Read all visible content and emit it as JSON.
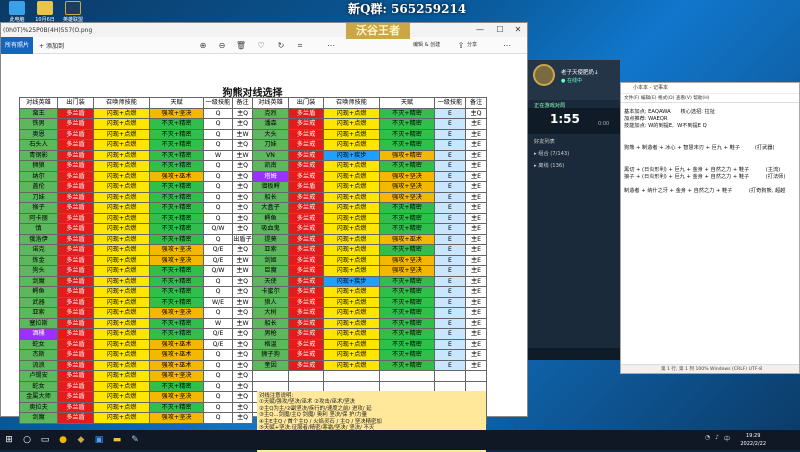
{
  "desktop": {
    "icons": [
      {
        "label": "此电脑",
        "color": "#3aa0e8"
      },
      {
        "label": "10月6日",
        "color": "#e8c44a"
      },
      {
        "label": "英雄联盟",
        "color": "#1f3c5c"
      }
    ],
    "qq_group": "新Q群: 565259214",
    "watermark": "沃谷王者"
  },
  "viewer": {
    "title": "(0h0T)%25P0B(4H)557(O.png",
    "all_photos": "所有照片",
    "add": "+ 添加到",
    "edit_create": "编辑 & 创建",
    "share": "分享",
    "controls": {
      "minimize": "—",
      "maximize": "☐",
      "close": "✕"
    }
  },
  "sheet": {
    "title": "狗熊对线选择",
    "headers": [
      "对线英雄",
      "出门装",
      "召唤师技能",
      "天赋",
      "一级技能",
      "备注",
      "对线英雄",
      "出门装",
      "召唤师技能",
      "天赋",
      "一级技能",
      "备注"
    ],
    "rows": [
      [
        [
          "蛮王",
          "g"
        ],
        [
          "多兰盾",
          "r"
        ],
        [
          "闪现+点燃",
          "y"
        ],
        [
          "强攻+坚决",
          "o"
        ],
        [
          "Q",
          "w"
        ],
        [
          "主Q",
          "w"
        ],
        [
          "克烈",
          "g"
        ],
        [
          "多兰盾",
          "r"
        ],
        [
          "闪现+点燃",
          "y"
        ],
        [
          "不灭+精密",
          "gr"
        ],
        [
          "E",
          "lb"
        ],
        [
          "主Q",
          "w"
        ]
      ],
      [
        [
          "铁男",
          "g"
        ],
        [
          "多兰盾",
          "r"
        ],
        [
          "闪现+点燃",
          "y"
        ],
        [
          "不灭+精密",
          "gr"
        ],
        [
          "Q",
          "w"
        ],
        [
          "主Q",
          "w"
        ],
        [
          "潘森",
          "g"
        ],
        [
          "多兰戒",
          "r"
        ],
        [
          "闪现+点燃",
          "y"
        ],
        [
          "不灭+精密",
          "gr"
        ],
        [
          "E",
          "lb"
        ],
        [
          "主E",
          "w"
        ]
      ],
      [
        [
          "奥恩",
          "g"
        ],
        [
          "多兰盾",
          "r"
        ],
        [
          "闪现+点燃",
          "y"
        ],
        [
          "不灭+精密",
          "gr"
        ],
        [
          "Q",
          "w"
        ],
        [
          "主W",
          "w"
        ],
        [
          "大头",
          "g"
        ],
        [
          "多兰戒",
          "r"
        ],
        [
          "闪现+点燃",
          "y"
        ],
        [
          "不灭+精密",
          "gr"
        ],
        [
          "E",
          "lb"
        ],
        [
          "主E",
          "w"
        ]
      ],
      [
        [
          "石头人",
          "g"
        ],
        [
          "多兰盾",
          "r"
        ],
        [
          "闪现+点燃",
          "y"
        ],
        [
          "不灭+精密",
          "gr"
        ],
        [
          "Q",
          "w"
        ],
        [
          "主Q",
          "w"
        ],
        [
          "刀妹",
          "g"
        ],
        [
          "多兰戒",
          "r"
        ],
        [
          "闪现+点燃",
          "y"
        ],
        [
          "不灭+精密",
          "gr"
        ],
        [
          "E",
          "lb"
        ],
        [
          "主E",
          "w"
        ]
      ],
      [
        [
          "青钢影",
          "g"
        ],
        [
          "多兰盾",
          "r"
        ],
        [
          "闪现+点燃",
          "y"
        ],
        [
          "不灭+精密",
          "gr"
        ],
        [
          "W",
          "w"
        ],
        [
          "主W",
          "w"
        ],
        [
          "VN",
          "g"
        ],
        [
          "多兰戒",
          "r"
        ],
        [
          "闪现+疾步",
          "b"
        ],
        [
          "强攻+精密",
          "o"
        ],
        [
          "E",
          "lb"
        ],
        [
          "主E",
          "w"
        ]
      ],
      [
        [
          "狮狼",
          "g"
        ],
        [
          "多兰盾",
          "r"
        ],
        [
          "闪现+点燃",
          "y"
        ],
        [
          "不灭+精密",
          "gr"
        ],
        [
          "Q",
          "w"
        ],
        [
          "主Q",
          "w"
        ],
        [
          "凯南",
          "g"
        ],
        [
          "多兰戒",
          "r"
        ],
        [
          "闪现+点燃",
          "y"
        ],
        [
          "不灭+精密",
          "gr"
        ],
        [
          "E",
          "lb"
        ],
        [
          "主E",
          "w"
        ]
      ],
      [
        [
          "纳尔",
          "g"
        ],
        [
          "多兰盾",
          "r"
        ],
        [
          "闪现+点燃",
          "y"
        ],
        [
          "强攻+巫术",
          "o"
        ],
        [
          "Q",
          "w"
        ],
        [
          "主Q",
          "w"
        ],
        [
          "塔姆",
          "p"
        ],
        [
          "多兰戒",
          "r"
        ],
        [
          "闪现+点燃",
          "y"
        ],
        [
          "强攻+坚决",
          "o"
        ],
        [
          "E",
          "lb"
        ],
        [
          "主E",
          "w"
        ]
      ],
      [
        [
          "盖伦",
          "g"
        ],
        [
          "多兰盾",
          "r"
        ],
        [
          "闪现+点燃",
          "y"
        ],
        [
          "不灭+精密",
          "gr"
        ],
        [
          "Q",
          "w"
        ],
        [
          "主Q",
          "w"
        ],
        [
          "潜板鳄",
          "g"
        ],
        [
          "多兰盾",
          "r"
        ],
        [
          "闪现+点燃",
          "y"
        ],
        [
          "强攻+坚决",
          "o"
        ],
        [
          "E",
          "lb"
        ],
        [
          "主E",
          "w"
        ]
      ],
      [
        [
          "刀妹",
          "g"
        ],
        [
          "多兰盾",
          "r"
        ],
        [
          "闪现+点燃",
          "y"
        ],
        [
          "不灭+精密",
          "gr"
        ],
        [
          "Q",
          "w"
        ],
        [
          "主Q",
          "w"
        ],
        [
          "船长",
          "g"
        ],
        [
          "多兰戒",
          "r"
        ],
        [
          "闪现+点燃",
          "y"
        ],
        [
          "强攻+坚决",
          "o"
        ],
        [
          "E",
          "lb"
        ],
        [
          "主E",
          "w"
        ]
      ],
      [
        [
          "猴子",
          "g"
        ],
        [
          "多兰盾",
          "r"
        ],
        [
          "闪现+点燃",
          "y"
        ],
        [
          "不灭+精密",
          "gr"
        ],
        [
          "Q",
          "w"
        ],
        [
          "主Q",
          "w"
        ],
        [
          "大盒子",
          "g"
        ],
        [
          "多兰戒",
          "r"
        ],
        [
          "闪现+点燃",
          "y"
        ],
        [
          "不灭+精密",
          "gr"
        ],
        [
          "E",
          "lb"
        ],
        [
          "主E",
          "w"
        ]
      ],
      [
        [
          "阿卡丽",
          "g"
        ],
        [
          "多兰盾",
          "r"
        ],
        [
          "闪现+点燃",
          "y"
        ],
        [
          "不灭+精密",
          "gr"
        ],
        [
          "Q",
          "w"
        ],
        [
          "主Q",
          "w"
        ],
        [
          "鳄鱼",
          "g"
        ],
        [
          "多兰戒",
          "r"
        ],
        [
          "闪现+点燃",
          "y"
        ],
        [
          "不灭+精密",
          "gr"
        ],
        [
          "E",
          "lb"
        ],
        [
          "主E",
          "w"
        ]
      ],
      [
        [
          "慎",
          "g"
        ],
        [
          "多兰盾",
          "r"
        ],
        [
          "闪现+点燃",
          "y"
        ],
        [
          "不灭+精密",
          "gr"
        ],
        [
          "Q/W",
          "w"
        ],
        [
          "主Q",
          "w"
        ],
        [
          "吸血鬼",
          "g"
        ],
        [
          "多兰戒",
          "r"
        ],
        [
          "闪现+点燃",
          "y"
        ],
        [
          "不灭+精密",
          "gr"
        ],
        [
          "E",
          "lb"
        ],
        [
          "主E",
          "w"
        ]
      ],
      [
        [
          "俄洛伊",
          "g"
        ],
        [
          "多兰盾",
          "r"
        ],
        [
          "闪现+点燃",
          "y"
        ],
        [
          "不灭+精密",
          "gr"
        ],
        [
          "Q",
          "w"
        ],
        [
          "出盾子",
          "w"
        ],
        [
          "提莫",
          "g"
        ],
        [
          "多兰戒",
          "r"
        ],
        [
          "闪现+点燃",
          "y"
        ],
        [
          "强攻+巫术",
          "o"
        ],
        [
          "E",
          "lb"
        ],
        [
          "主E",
          "w"
        ]
      ],
      [
        [
          "诺克",
          "g"
        ],
        [
          "多兰盾",
          "r"
        ],
        [
          "闪现+点燃",
          "y"
        ],
        [
          "强攻+坚决",
          "o"
        ],
        [
          "Q/E",
          "w"
        ],
        [
          "主Q",
          "w"
        ],
        [
          "亚索",
          "g"
        ],
        [
          "多兰戒",
          "r"
        ],
        [
          "闪现+点燃",
          "y"
        ],
        [
          "不灭+精密",
          "gr"
        ],
        [
          "E",
          "lb"
        ],
        [
          "主E",
          "w"
        ]
      ],
      [
        [
          "炼金",
          "g"
        ],
        [
          "多兰盾",
          "r"
        ],
        [
          "闪现+点燃",
          "y"
        ],
        [
          "强攻+坚决",
          "o"
        ],
        [
          "Q/E",
          "w"
        ],
        [
          "主W",
          "w"
        ],
        [
          "剑姬",
          "g"
        ],
        [
          "多兰戒",
          "r"
        ],
        [
          "闪现+点燃",
          "y"
        ],
        [
          "强攻+坚决",
          "o"
        ],
        [
          "E",
          "lb"
        ],
        [
          "主E",
          "w"
        ]
      ],
      [
        [
          "狗头",
          "g"
        ],
        [
          "多兰盾",
          "r"
        ],
        [
          "闪现+点燃",
          "y"
        ],
        [
          "不灭+精密",
          "gr"
        ],
        [
          "Q/W",
          "w"
        ],
        [
          "主W",
          "w"
        ],
        [
          "巨魔",
          "g"
        ],
        [
          "多兰戒",
          "r"
        ],
        [
          "闪现+点燃",
          "y"
        ],
        [
          "强攻+坚决",
          "o"
        ],
        [
          "E",
          "lb"
        ],
        [
          "主E",
          "w"
        ]
      ],
      [
        [
          "剑魔",
          "g"
        ],
        [
          "多兰盾",
          "r"
        ],
        [
          "闪现+点燃",
          "y"
        ],
        [
          "不灭+精密",
          "gr"
        ],
        [
          "Q",
          "w"
        ],
        [
          "主Q",
          "w"
        ],
        [
          "天使",
          "g"
        ],
        [
          "多兰戒",
          "r"
        ],
        [
          "闪现+疾步",
          "b"
        ],
        [
          "不灭+精密",
          "gr"
        ],
        [
          "E",
          "lb"
        ],
        [
          "主E",
          "w"
        ]
      ],
      [
        [
          "鳄鱼",
          "g"
        ],
        [
          "多兰盾",
          "r"
        ],
        [
          "闪现+点燃",
          "y"
        ],
        [
          "不灭+精密",
          "gr"
        ],
        [
          "Q",
          "w"
        ],
        [
          "主Q",
          "w"
        ],
        [
          "卡蜜尔",
          "g"
        ],
        [
          "多兰戒",
          "r"
        ],
        [
          "闪现+点燃",
          "y"
        ],
        [
          "不灭+精密",
          "gr"
        ],
        [
          "E",
          "lb"
        ],
        [
          "主E",
          "w"
        ]
      ],
      [
        [
          "武器",
          "g"
        ],
        [
          "多兰盾",
          "r"
        ],
        [
          "闪现+点燃",
          "y"
        ],
        [
          "不灭+精密",
          "gr"
        ],
        [
          "W/E",
          "w"
        ],
        [
          "主W",
          "w"
        ],
        [
          "狼人",
          "g"
        ],
        [
          "多兰戒",
          "r"
        ],
        [
          "闪现+点燃",
          "y"
        ],
        [
          "不灭+精密",
          "gr"
        ],
        [
          "E",
          "lb"
        ],
        [
          "主E",
          "w"
        ]
      ],
      [
        [
          "亚索",
          "g"
        ],
        [
          "多兰盾",
          "r"
        ],
        [
          "闪现+点燃",
          "y"
        ],
        [
          "强攻+坚决",
          "o"
        ],
        [
          "Q",
          "w"
        ],
        [
          "主Q",
          "w"
        ],
        [
          "大树",
          "g"
        ],
        [
          "多兰戒",
          "r"
        ],
        [
          "闪现+点燃",
          "y"
        ],
        [
          "不灭+精密",
          "gr"
        ],
        [
          "E",
          "lb"
        ],
        [
          "主E",
          "w"
        ]
      ],
      [
        [
          "塞拉斯",
          "g"
        ],
        [
          "多兰盾",
          "r"
        ],
        [
          "闪现+点燃",
          "y"
        ],
        [
          "不灭+精密",
          "gr"
        ],
        [
          "W",
          "w"
        ],
        [
          "主W",
          "w"
        ],
        [
          "船长",
          "g"
        ],
        [
          "多兰戒",
          "r"
        ],
        [
          "闪现+点燃",
          "y"
        ],
        [
          "不灭+精密",
          "gr"
        ],
        [
          "E",
          "lb"
        ],
        [
          "主E",
          "w"
        ]
      ],
      [
        [
          "酒桶",
          "p"
        ],
        [
          "多兰盾",
          "r"
        ],
        [
          "闪现+点燃",
          "y"
        ],
        [
          "不灭+精密",
          "gr"
        ],
        [
          "Q/E",
          "w"
        ],
        [
          "主Q",
          "w"
        ],
        [
          "男枪",
          "g"
        ],
        [
          "多兰戒",
          "r"
        ],
        [
          "闪现+点燃",
          "y"
        ],
        [
          "不灭+精密",
          "gr"
        ],
        [
          "E",
          "lb"
        ],
        [
          "主E",
          "w"
        ]
      ],
      [
        [
          "蛇女",
          "g"
        ],
        [
          "多兰盾",
          "r"
        ],
        [
          "闪现+点燃",
          "y"
        ],
        [
          "强攻+巫术",
          "o"
        ],
        [
          "Q/E",
          "w"
        ],
        [
          "主Q",
          "w"
        ],
        [
          "格温",
          "g"
        ],
        [
          "多兰戒",
          "r"
        ],
        [
          "闪现+点燃",
          "y"
        ],
        [
          "不灭+精密",
          "gr"
        ],
        [
          "E",
          "lb"
        ],
        [
          "主E",
          "w"
        ]
      ],
      [
        [
          "杰斯",
          "g"
        ],
        [
          "多兰盾",
          "r"
        ],
        [
          "闪现+点燃",
          "y"
        ],
        [
          "强攻+巫术",
          "o"
        ],
        [
          "Q",
          "w"
        ],
        [
          "主Q",
          "w"
        ],
        [
          "狮子狗",
          "g"
        ],
        [
          "多兰戒",
          "r"
        ],
        [
          "闪现+点燃",
          "y"
        ],
        [
          "不灭+精密",
          "gr"
        ],
        [
          "E",
          "lb"
        ],
        [
          "主E",
          "w"
        ]
      ],
      [
        [
          "流浪",
          "g"
        ],
        [
          "多兰盾",
          "r"
        ],
        [
          "闪现+点燃",
          "y"
        ],
        [
          "强攻+巫术",
          "o"
        ],
        [
          "Q",
          "w"
        ],
        [
          "主Q",
          "w"
        ],
        [
          "奎因",
          "g"
        ],
        [
          "多兰戒",
          "r"
        ],
        [
          "闪现+点燃",
          "y"
        ],
        [
          "不灭+精密",
          "gr"
        ],
        [
          "E",
          "lb"
        ],
        [
          "主E",
          "w"
        ]
      ],
      [
        [
          "卢锡安",
          "g"
        ],
        [
          "多兰盾",
          "r"
        ],
        [
          "闪现+点燃",
          "y"
        ],
        [
          "强攻+坚决",
          "o"
        ],
        [
          "Q",
          "w"
        ],
        [
          "主Q",
          "w"
        ]
      ],
      [
        [
          "蛇女",
          "g"
        ],
        [
          "多兰盾",
          "r"
        ],
        [
          "闪现+点燃",
          "y"
        ],
        [
          "不灭+精密",
          "gr"
        ],
        [
          "Q",
          "w"
        ],
        [
          "主Q",
          "w"
        ]
      ],
      [
        [
          "金属大师",
          "g"
        ],
        [
          "多兰盾",
          "r"
        ],
        [
          "闪现+点燃",
          "y"
        ],
        [
          "强攻+坚决",
          "o"
        ],
        [
          "Q",
          "w"
        ],
        [
          "主Q",
          "w"
        ]
      ],
      [
        [
          "奥拉夫",
          "g"
        ],
        [
          "多兰盾",
          "r"
        ],
        [
          "闪现+点燃",
          "y"
        ],
        [
          "不灭+精密",
          "gr"
        ],
        [
          "Q",
          "w"
        ],
        [
          "主Q",
          "w"
        ]
      ],
      [
        [
          "剑魔",
          "g"
        ],
        [
          "多兰盾",
          "r"
        ],
        [
          "闪现+点燃",
          "y"
        ],
        [
          "强攻+坚决",
          "o"
        ],
        [
          "Q",
          "w"
        ],
        [
          "主Q",
          "w"
        ]
      ]
    ],
    "notes": [
      "对线注意说明:",
      "①天赋/强攻/坚决/巫术 ②攻击/巫术/坚决",
      "②主Q为主/②副坚决/疾行的/速度之前/ 进攻/ 延",
      "③主Q...剑魔/主Q 剑魔/ 奥利 坚决/保 护/力量",
      "④主E主Q / 首个主Q / 火焰灵石 / 主Q / 坚决精密加",
      "⑤天赋+坚决:征服者/精密/寒霜/坚决/ 坚决/ 不灭",
      "以上则供参考! ! !"
    ]
  },
  "overlay": {
    "name": "老子天使肥奶↓",
    "sub": "● 在线中",
    "timer": "1:55",
    "timer2": "0:00",
    "status": "正在游戏对局",
    "friends_label": "好友列表",
    "row1": "▸ 组合 (7/143)",
    "row2": "▸ 离线 (136)"
  },
  "notepad": {
    "title": "小本本 - 记事本",
    "menu": "文件(F)  编辑(E)  格式(O)  查看(V)  帮助(H)",
    "lines": [
      "基本加点: EAQAWA      核心选招: 拉扯",
      "加点推荐: WAEQR",
      "技能加点: W的到提E,  W不到提E Q",
      "",
      "",
      "狗熊 + 制造者 + 冰心 + 智慧末刃 + 巨九 + 鞋子         (打武器)",
      "",
      "",
      "黑切 + (日炎形利) + 巨九 + 金身 + 自然之力 + 鞋子          (主流)",
      "狼子 + (日炎形利) + 巨九 + 金身 + 自然之力 + 鞋子          (打法师)",
      "",
      "制造者 + 纳什之牙 + 金身 + 自然之力 + 鞋子          (打奇狗熊, 超越"
    ],
    "status": "第 1 行, 第 1 列     100%     Windows (CRLF)     UTF-8"
  },
  "taskbar": {
    "start": "⊞",
    "time": "19:29",
    "date": "2022/2/22"
  }
}
